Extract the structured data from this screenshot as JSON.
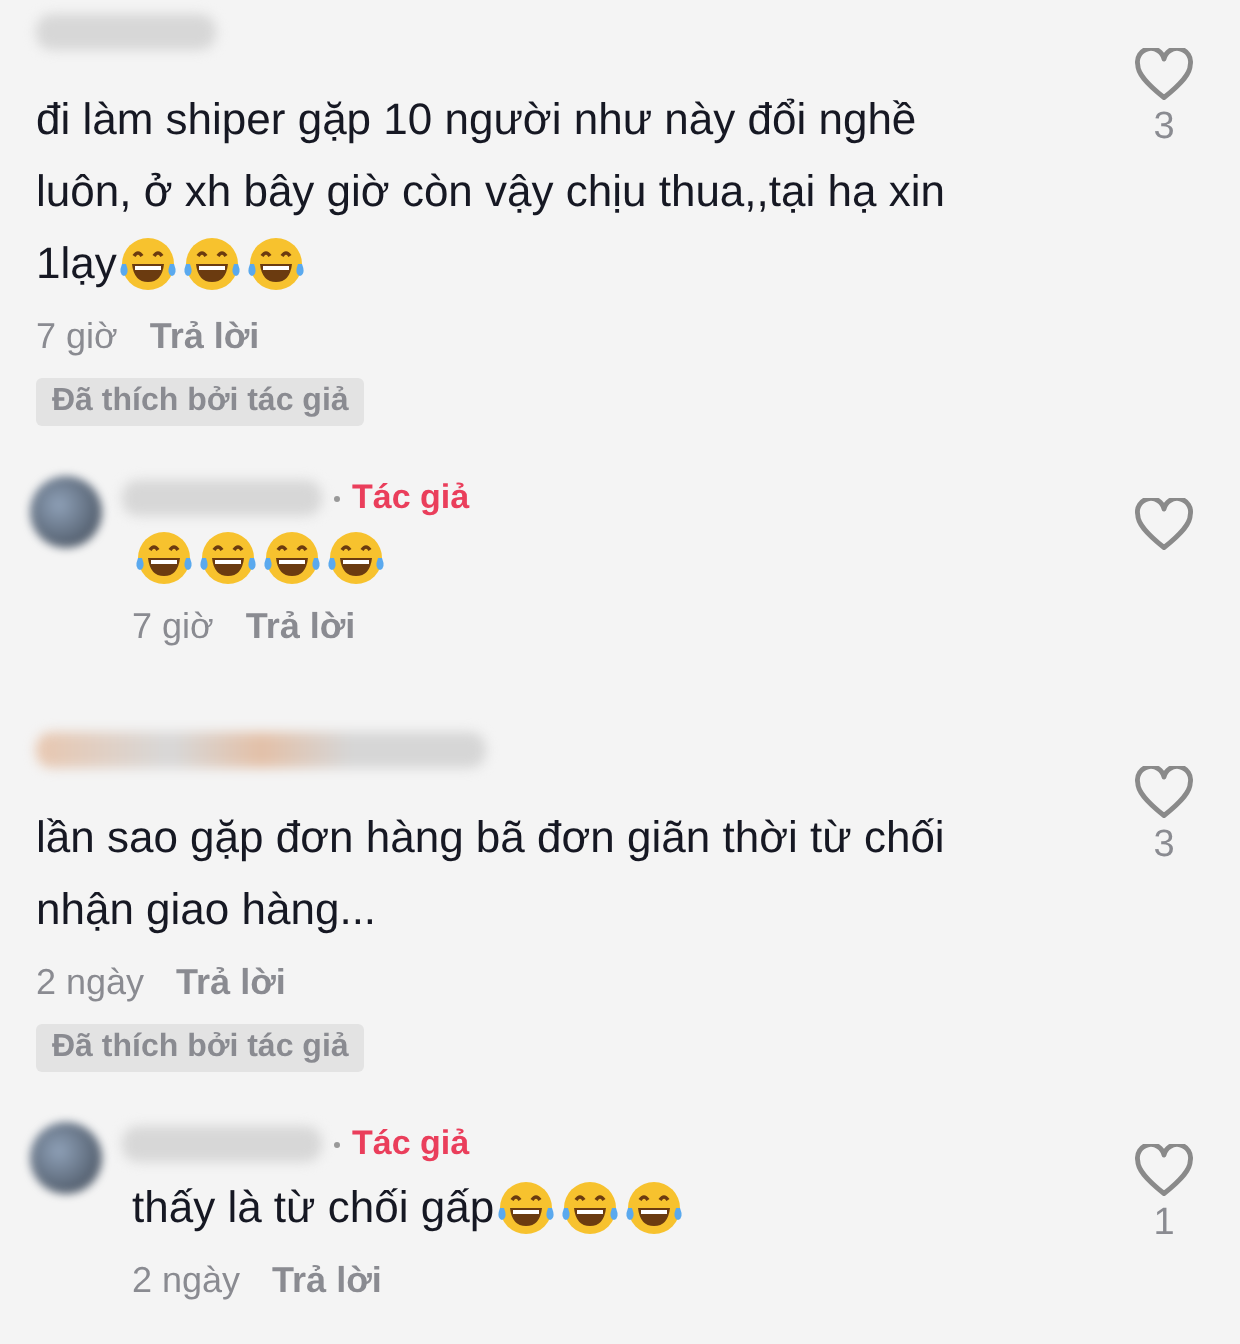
{
  "comments": [
    {
      "reply": false,
      "lines": [
        "đi làm shiper gặp 10 người như này đổi nghề",
        "luôn, ở xh bây giờ còn vậy chịu thua,,tại hạ xin",
        "1lạy"
      ],
      "emojis": [
        {
          "kind": "tears-of-joy"
        },
        {
          "kind": "tears-of-joy"
        },
        {
          "kind": "tears-of-joy"
        }
      ],
      "time": "7 giờ",
      "reply_label": "Trả lời",
      "likes": "3",
      "liked_by_author": "Đã thích bởi tác giả"
    },
    {
      "reply": true,
      "author_badge": "Tác giả",
      "emojis": [
        {
          "kind": "tears-of-joy"
        },
        {
          "kind": "tears-of-joy"
        },
        {
          "kind": "tears-of-joy"
        },
        {
          "kind": "tears-of-joy"
        }
      ],
      "time": "7 giờ",
      "reply_label": "Trả lời"
    },
    {
      "reply": false,
      "lines": [
        "lần sao gặp đơn hàng bã đơn giãn thời từ chối",
        "nhận giao hàng..."
      ],
      "time": "2 ngày",
      "reply_label": "Trả lời",
      "likes": "3",
      "liked_by_author": "Đã thích bởi tác giả"
    },
    {
      "reply": true,
      "author_badge": "Tác giả",
      "lines": [
        "thấy là từ chối gấp "
      ],
      "emojis": [
        {
          "kind": "tears-of-joy"
        },
        {
          "kind": "tears-of-joy"
        },
        {
          "kind": "tears-of-joy"
        }
      ],
      "time": "2 ngày",
      "reply_label": "Trả lời",
      "likes": "1"
    }
  ]
}
